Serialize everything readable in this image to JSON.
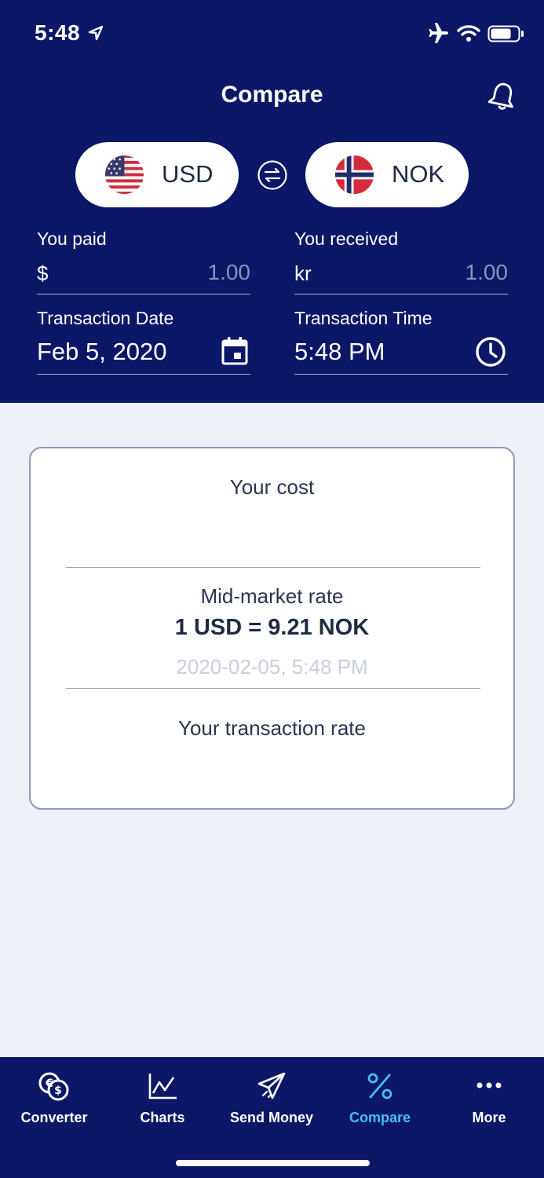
{
  "status_bar": {
    "time": "5:48"
  },
  "header": {
    "title": "Compare",
    "from_currency": "USD",
    "to_currency": "NOK",
    "paid_label": "You paid",
    "paid_symbol": "$",
    "paid_amount": "1.00",
    "received_label": "You received",
    "received_symbol": "kr",
    "received_amount": "1.00",
    "date_label": "Transaction Date",
    "date_value": "Feb 5, 2020",
    "time_label": "Transaction Time",
    "time_value": "5:48 PM"
  },
  "card": {
    "cost_label": "Your cost",
    "mid_label": "Mid-market rate",
    "rate": "1 USD = 9.21 NOK",
    "rate_timestamp": "2020-02-05, 5:48 PM",
    "transaction_label": "Your transaction rate"
  },
  "tabs": [
    {
      "label": "Converter",
      "icon": "converter-icon"
    },
    {
      "label": "Charts",
      "icon": "chart-icon"
    },
    {
      "label": "Send Money",
      "icon": "paper-plane-icon"
    },
    {
      "label": "Compare",
      "icon": "percent-icon",
      "active": true
    },
    {
      "label": "More",
      "icon": "more-dots-icon"
    }
  ],
  "colors": {
    "header_bg": "#0c1767",
    "page_bg": "#eef1f7",
    "active_tab": "#47bff0"
  }
}
